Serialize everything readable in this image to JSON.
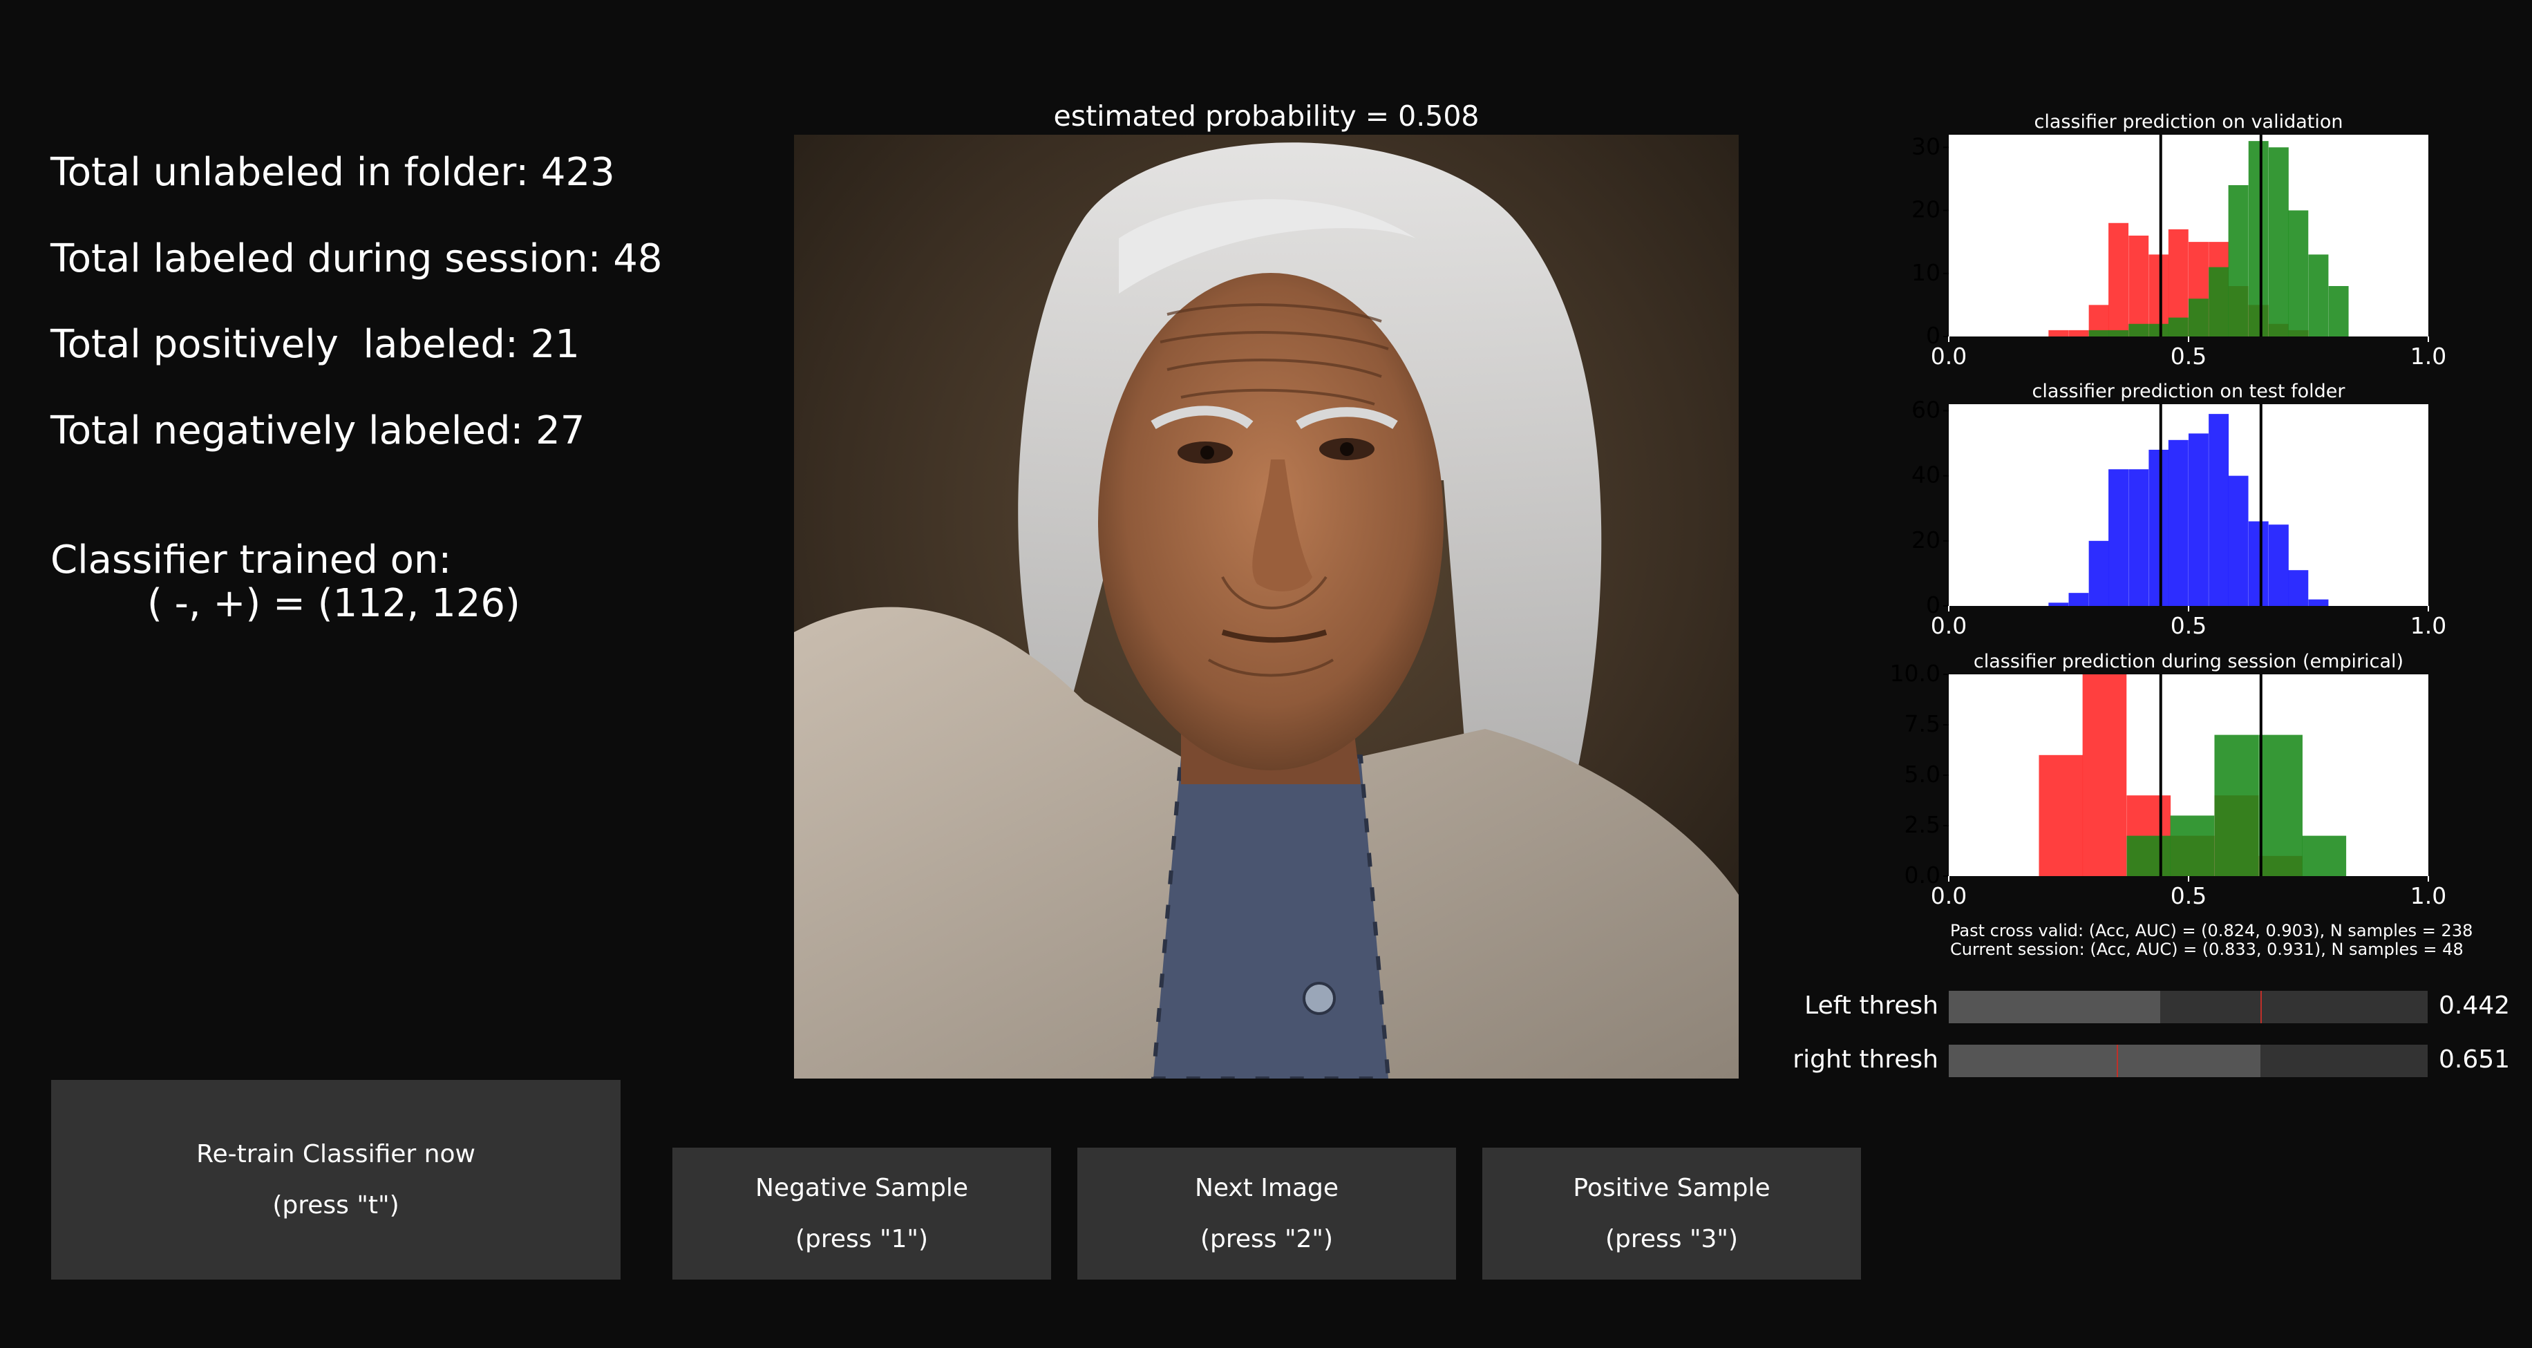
{
  "stats": {
    "unlabeled": "Total unlabeled in folder: 423",
    "labeled_session": "Total labeled during session: 48",
    "positive": "Total positively  labeled: 21",
    "negative": "Total negatively labeled: 27",
    "trained_title": "Classifier trained on:",
    "trained_counts": "( -, +) = (112, 126)"
  },
  "image": {
    "title": "estimated probability = 0.508"
  },
  "colors": {
    "background": "#0c0c0c",
    "negative": "#ff2a2a",
    "positive": "#1a8a1a",
    "test": "#2222ff",
    "button": "#333333",
    "slider_fill": "#555555",
    "slider_marker": "#c0302a"
  },
  "chart_data": [
    {
      "type": "bar",
      "title": "classifier prediction on validation",
      "xlim": [
        0.0,
        1.0
      ],
      "ylim": [
        0,
        32
      ],
      "xticks": [
        "0.0",
        "0.5",
        "1.0"
      ],
      "yticks": [
        "0",
        "10",
        "20",
        "30"
      ],
      "bin_width": 0.0417,
      "vlines": [
        0.442,
        0.651
      ],
      "series": [
        {
          "color": "red",
          "x": [
            0.208,
            0.25,
            0.292,
            0.333,
            0.375,
            0.417,
            0.458,
            0.5,
            0.542,
            0.583,
            0.625,
            0.667,
            0.708
          ],
          "values": [
            1,
            1,
            5,
            18,
            16,
            13,
            17,
            15,
            15,
            8,
            5,
            2,
            1
          ]
        },
        {
          "color": "green",
          "x": [
            0.25,
            0.292,
            0.333,
            0.375,
            0.417,
            0.458,
            0.5,
            0.542,
            0.583,
            0.625,
            0.667,
            0.708,
            0.75,
            0.792
          ],
          "values": [
            0,
            1,
            1,
            2,
            2,
            3,
            6,
            11,
            24,
            31,
            30,
            20,
            13,
            8
          ]
        }
      ]
    },
    {
      "type": "bar",
      "title": "classifier prediction on test folder",
      "xlim": [
        0.0,
        1.0
      ],
      "ylim": [
        0,
        62
      ],
      "xticks": [
        "0.0",
        "0.5",
        "1.0"
      ],
      "yticks": [
        "0",
        "20",
        "40",
        "60"
      ],
      "bin_width": 0.0417,
      "vlines": [
        0.442,
        0.651
      ],
      "series": [
        {
          "color": "blue",
          "x": [
            0.208,
            0.25,
            0.292,
            0.333,
            0.375,
            0.417,
            0.458,
            0.5,
            0.542,
            0.583,
            0.625,
            0.667,
            0.708,
            0.75,
            0.792
          ],
          "values": [
            1,
            4,
            20,
            42,
            42,
            48,
            51,
            53,
            59,
            40,
            26,
            25,
            11,
            2,
            0
          ]
        }
      ]
    },
    {
      "type": "bar",
      "title": "classifier prediction during session (empirical)",
      "xlim": [
        0.0,
        1.0
      ],
      "ylim": [
        0,
        10
      ],
      "xticks": [
        "0.0",
        "0.5",
        "1.0"
      ],
      "yticks": [
        "0.0",
        "2.5",
        "5.0",
        "7.5",
        "10.0"
      ],
      "bin_width": 0.0917,
      "vlines": [
        0.442,
        0.651
      ],
      "series": [
        {
          "color": "red",
          "x": [
            0.188,
            0.279,
            0.371,
            0.462,
            0.554,
            0.646
          ],
          "values": [
            6,
            10,
            4,
            2,
            4,
            1
          ]
        },
        {
          "color": "green",
          "x": [
            0.371,
            0.462,
            0.554,
            0.646,
            0.737
          ],
          "values": [
            2,
            3,
            7,
            7,
            2
          ]
        }
      ]
    }
  ],
  "metrics": {
    "past": "Past cross valid: (Acc, AUC) = (0.824, 0.903), N samples = 238",
    "current": "Current session: (Acc, AUC) = (0.833, 0.931), N samples = 48"
  },
  "sliders": {
    "left": {
      "label": "Left thresh",
      "value": "0.442",
      "fill_fraction": 0.442,
      "marker_fraction": 0.651
    },
    "right": {
      "label": "right thresh",
      "value": "0.651",
      "fill_fraction": 0.651,
      "marker_fraction": 0.35
    }
  },
  "buttons": {
    "retrain": {
      "line1": "Re-train Classifier now",
      "line2": "(press \"t\")"
    },
    "negative": {
      "line1": "Negative Sample",
      "line2": "(press \"1\")"
    },
    "next": {
      "line1": "Next Image",
      "line2": "(press \"2\")"
    },
    "positive": {
      "line1": "Positive Sample",
      "line2": "(press \"3\")"
    }
  }
}
